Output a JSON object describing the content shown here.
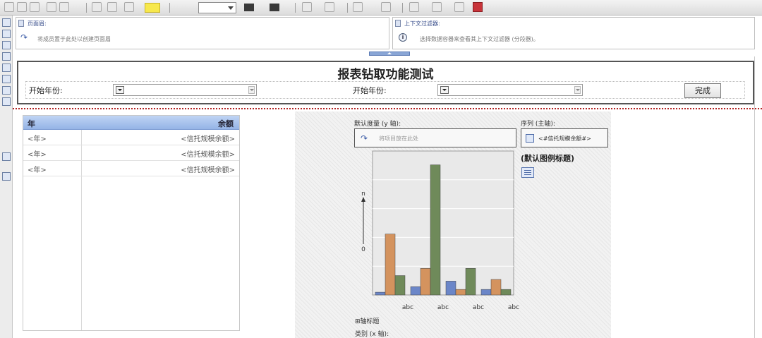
{
  "page_header": {
    "title": "页面眉:",
    "hint": "将成员置于此处以创建页面眉"
  },
  "context_filter": {
    "title": "上下文过滤器:",
    "hint": "选择数据容器来查看其上下文过滤器 (分段器)。"
  },
  "prompt": {
    "report_title": "报表钻取功能测试",
    "start_year_label_1": "开始年份:",
    "start_year_label_2": "开始年份:",
    "finish_button": "完成"
  },
  "list": {
    "headers": {
      "year": "年",
      "balance": "余额"
    },
    "rows": [
      {
        "year": "<年>",
        "balance": "<信托规模余额>"
      },
      {
        "year": "<年>",
        "balance": "<信托规模余额>"
      },
      {
        "year": "<年>",
        "balance": "<信托规模余额>"
      }
    ]
  },
  "chart_panel": {
    "y_axis_label": "默认度量 (y 轴):",
    "drop_hint": "将项目放在此处",
    "series_label": "序列 (主轴):",
    "series_item": "<#信托规模余额#>",
    "legend_title": "(默认图例标题)",
    "axis_title_toggle": "⊞轴标题",
    "category_label": "类别 (x 轴):"
  },
  "chart_data": {
    "type": "bar",
    "categories": [
      "abc",
      "abc",
      "abc",
      "abc"
    ],
    "series": [
      {
        "values": [
          0.5,
          1.5,
          2.5,
          1.0
        ],
        "color": "#6b86c8"
      },
      {
        "values": [
          11.0,
          4.8,
          1.0,
          2.8
        ],
        "color": "#d4935e"
      },
      {
        "values": [
          3.5,
          23.5,
          4.8,
          1.0
        ],
        "color": "#6f8a5a"
      }
    ],
    "y_axis_ticks": [
      "n",
      "0"
    ],
    "ylim": [
      0,
      26
    ],
    "grid": true
  },
  "colors": {
    "header_blue": "#95b4e6",
    "accent_red": "#b22222"
  }
}
